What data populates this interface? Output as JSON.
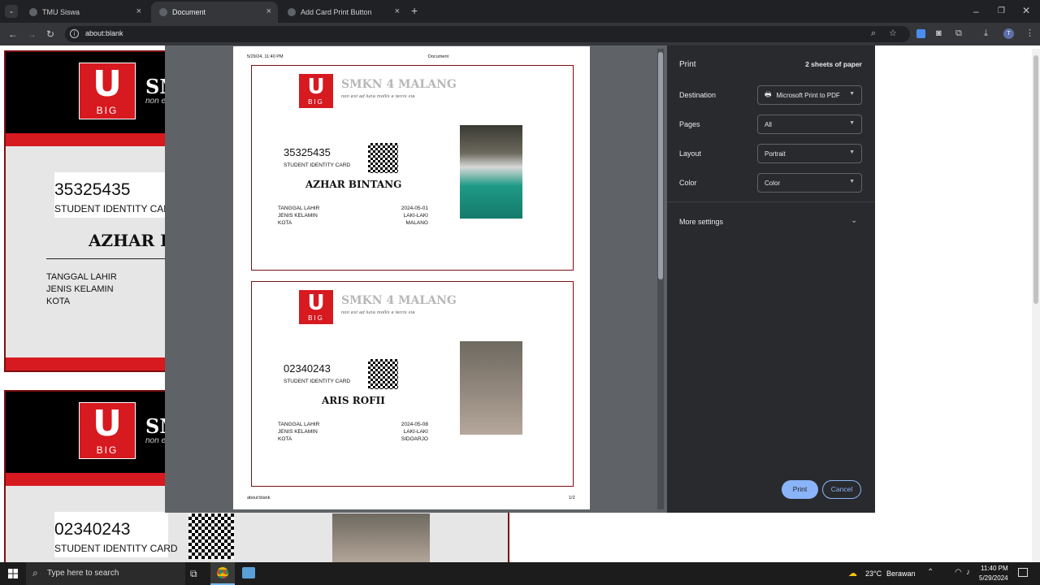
{
  "browser": {
    "tabs": [
      {
        "label": "TMU Siswa"
      },
      {
        "label": "Document"
      },
      {
        "label": "Add Card Print Button"
      }
    ],
    "address": "about:blank"
  },
  "school": {
    "name": "SMKN 4 MALANG",
    "motto": "non est ad luna mollis e terris via",
    "logo_letter": "U",
    "logo_sub": "BIG"
  },
  "labels": {
    "card_type": "STUDENT IDENTITY CARD",
    "dob": "TANGGAL LAHIR",
    "gender": "JENIS KELAMIN",
    "city": "KOTA"
  },
  "cards": [
    {
      "id": "35325435",
      "name": "AZHAR BINTANG",
      "dob": "2024-05-01",
      "gender": "LAKI-LAKI",
      "city": "MALANG"
    },
    {
      "id": "02340243",
      "name": "ARIS ROFII",
      "dob": "2024-05-08",
      "gender": "LAKI-LAKI",
      "city": "SIDOARJO"
    }
  ],
  "background_page": {
    "name_partial": "AZHAR B",
    "school_partial_1": "SM",
    "school_partial_2": "SM",
    "motto_partial": "non e"
  },
  "paper": {
    "header_date": "5/29/24, 11:40 PM",
    "header_title": "Document",
    "footer_url": "about:blank",
    "footer_page": "1/2"
  },
  "print_dialog": {
    "title": "Print",
    "sheets": "2 sheets of paper",
    "destination_label": "Destination",
    "destination_value": "Microsoft Print to PDF",
    "pages_label": "Pages",
    "pages_value": "All",
    "layout_label": "Layout",
    "layout_value": "Portrait",
    "color_label": "Color",
    "color_value": "Color",
    "more_settings": "More settings",
    "print_button": "Print",
    "cancel_button": "Cancel"
  },
  "taskbar": {
    "search_placeholder": "Type here to search",
    "weather_temp": "23°C",
    "weather_text": "Berawan",
    "time": "11:40 PM",
    "date": "5/29/2024"
  },
  "colors": {
    "accent_red": "#d71920",
    "card_border": "#7a1010",
    "print_button": "#8ab4f8"
  }
}
